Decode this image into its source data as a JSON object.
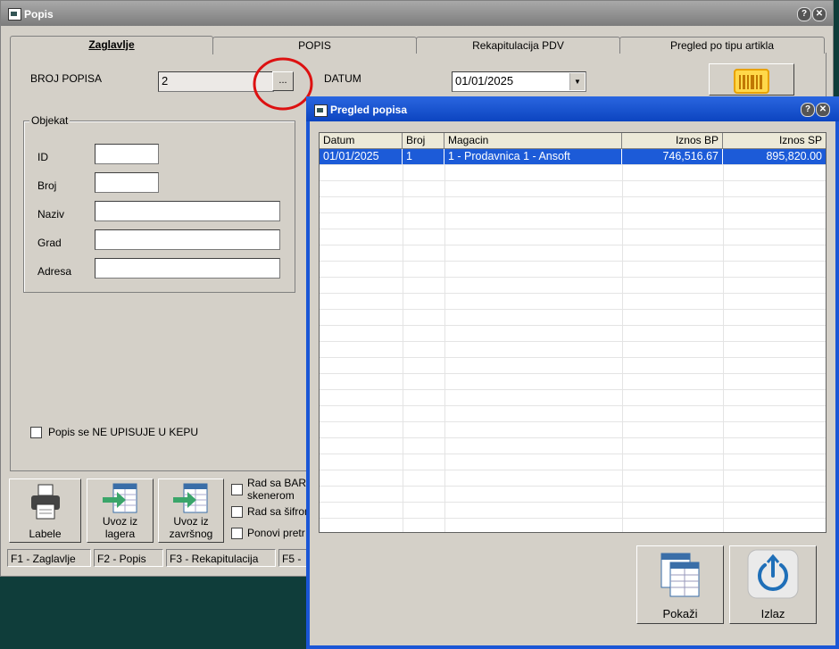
{
  "main_window": {
    "title": "Popis",
    "help_btn": "?",
    "close_btn": "✕",
    "tabs": [
      "Zaglavlje",
      "POPIS",
      "Rekapitulacija PDV",
      "Pregled po tipu artikla"
    ],
    "broj_popisa_label": "BROJ POPISA",
    "broj_popisa_value": "2",
    "browse_btn": "...",
    "datum_label": "DATUM",
    "datum_value": "01/01/2025",
    "dropdown_arrow": "▼",
    "objekat": {
      "legend": "Objekat",
      "fields": [
        {
          "label": "ID",
          "value": ""
        },
        {
          "label": "Broj",
          "value": ""
        },
        {
          "label": "Naziv",
          "value": ""
        },
        {
          "label": "Grad",
          "value": ""
        },
        {
          "label": "Adresa",
          "value": ""
        }
      ]
    },
    "kepu_checkbox": "Popis se NE UPISUJE U KEPU",
    "toolbar": {
      "labele": "Labele",
      "uvoz_lagera": [
        "Uvoz iz",
        "lagera"
      ],
      "uvoz_zavrsnog": [
        "Uvoz iz",
        "završnog"
      ],
      "rad_bar_1": "Rad sa BARC",
      "rad_bar_2": "skenerom",
      "rad_sifrom": "Rad sa šifrom",
      "ponovi": "Ponovi pretr"
    },
    "status": [
      "F1 - Zaglavlje",
      "F2 - Popis",
      "F3 - Rekapitulacija",
      "F5 -"
    ]
  },
  "modal": {
    "title": "Pregled popisa",
    "help_btn": "?",
    "close_btn": "✕",
    "columns": [
      "Datum",
      "Broj",
      "Magacin",
      "Iznos BP",
      "Iznos SP"
    ],
    "rows": [
      {
        "datum": "01/01/2025",
        "broj": "1",
        "magacin": "1 - Prodavnica 1 - Ansoft",
        "iznos_bp": "746,516.67",
        "iznos_sp": "895,820.00"
      }
    ],
    "pokazi": "Pokaži",
    "izlaz": "Izlaz"
  },
  "colors": {
    "highlight": "#1c5bd8",
    "modal_frame": "#1a56d6",
    "annotation_circle": "#dd1111"
  }
}
